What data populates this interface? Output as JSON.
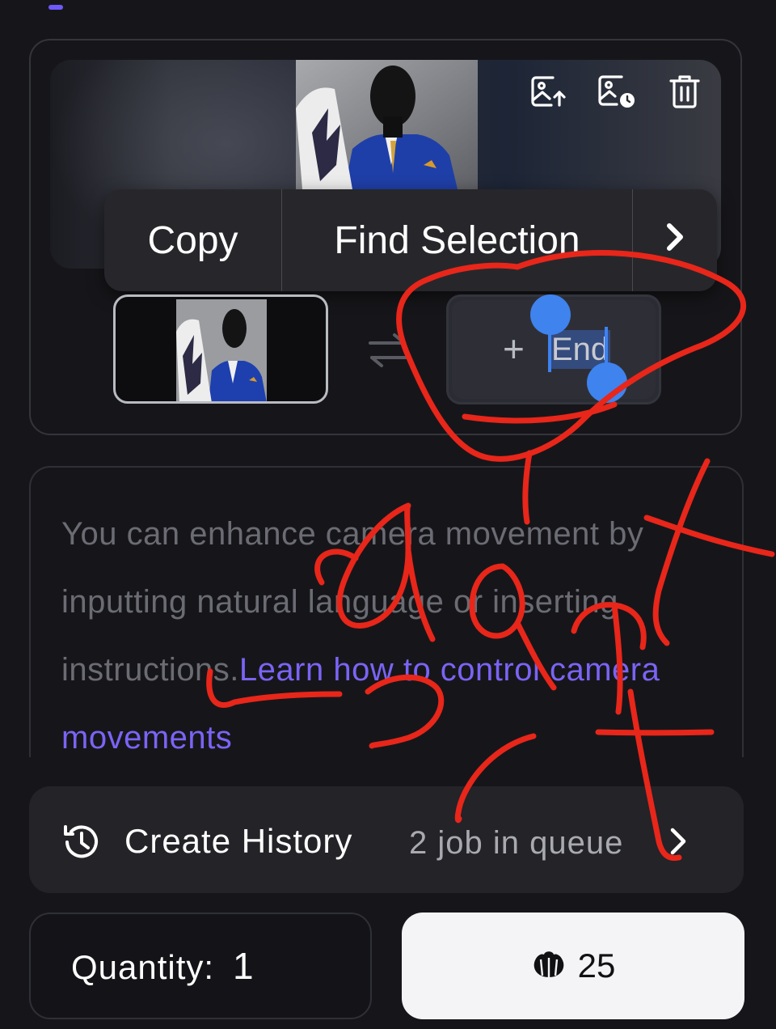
{
  "context_menu": {
    "copy": "Copy",
    "find_selection": "Find Selection",
    "more_icon": "chevron-right-icon"
  },
  "frames": {
    "upload_icon": "image-upload-icon",
    "history_icon": "image-history-icon",
    "delete_icon": "trash-icon",
    "swap_icon": "swap-arrows-icon",
    "end_plus": "+",
    "end_label": "End"
  },
  "prompt": {
    "placeholder": "You can enhance camera movement by inputting natural language or inserting instructions.",
    "link": "Learn how to control camera movements"
  },
  "history": {
    "label": "Create History",
    "queue": "2 job in queue",
    "icon": "history-clock-icon",
    "chevron": "chevron-right-icon"
  },
  "quantity": {
    "label": "Quantity:",
    "value": "1"
  },
  "generate": {
    "icon": "shell-credit-icon",
    "credits": "25"
  },
  "colors": {
    "accent": "#6e59ff",
    "link": "#7a64f5",
    "selection": "#3f83ee",
    "annotation": "#e8261a",
    "background": "#16161a"
  }
}
